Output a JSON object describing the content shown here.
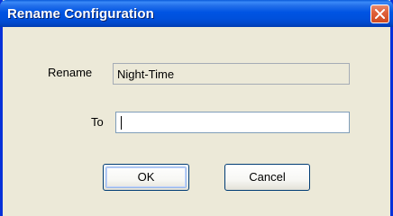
{
  "window": {
    "title": "Rename Configuration",
    "close_icon": "close-icon"
  },
  "form": {
    "rename_label": "Rename",
    "rename_value": "Night-Time",
    "to_label": "To",
    "to_value": ""
  },
  "buttons": {
    "ok_label": "OK",
    "cancel_label": "Cancel"
  },
  "colors": {
    "titlebar": "#0054e3",
    "dialog_background": "#ece9d8",
    "close_button": "#e0613b"
  }
}
